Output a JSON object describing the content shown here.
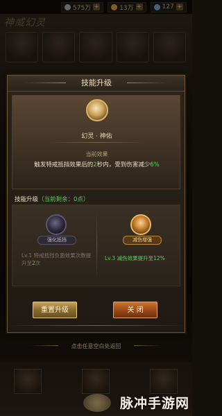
{
  "topbar": {
    "silver": "575万",
    "gold": "13万",
    "gems": "127"
  },
  "page": {
    "title": "神威幻灵"
  },
  "modal": {
    "title": "技能升级",
    "skill_name": "幻灵 · 神佑",
    "current_effect_label": "当前效果",
    "effect_prefix": "触发特戒抵挡效果后的",
    "effect_seconds": "2",
    "effect_mid": "秒内，受到伤害减少",
    "effect_percent": "6%",
    "upgrade_label": "技能升级",
    "remaining": "（当前剩余：0点）",
    "option_left": {
      "label": "强化抵挡",
      "desc_prefix": "Lv.1 特戒抵挡负面效果次数提升至",
      "desc_value": "2",
      "desc_suffix": "次"
    },
    "option_right": {
      "label": "减伤增强",
      "desc": "Lv.3 减伤效果提升至12%"
    },
    "button_upgrade": "重置升级",
    "button_close": "关  闭"
  },
  "hint": "点击任意空白处返回",
  "watermark": "脉冲手游网",
  "colors": {
    "accent_green": "#5bd35a",
    "gold_button": "#c9a45a",
    "orange_button": "#c9742f"
  }
}
